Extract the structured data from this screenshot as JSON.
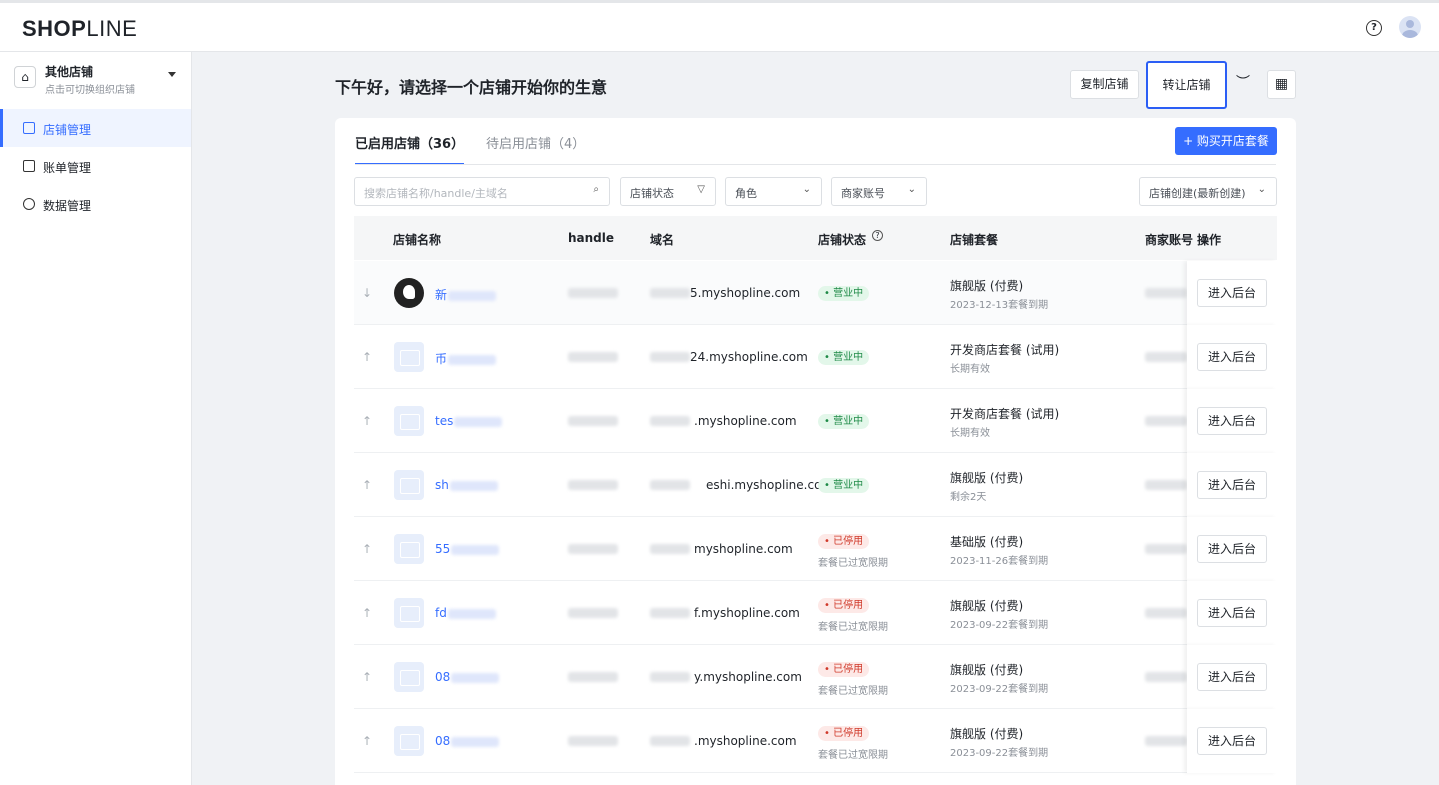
{
  "header": {
    "logo": "SHOPLINE",
    "help_icon": "question-circle-icon",
    "avatar_icon": "user-avatar-icon"
  },
  "sidebar": {
    "org_name": "其他店铺",
    "org_sub": "点击可切换组织店铺",
    "items": [
      {
        "label": "店铺管理",
        "icon": "store-icon",
        "active": true
      },
      {
        "label": "账单管理",
        "icon": "bill-icon",
        "active": false
      },
      {
        "label": "数据管理",
        "icon": "dashboard-icon",
        "active": false
      }
    ]
  },
  "main": {
    "greeting": "下午好，请选择一个店铺开始你的生意",
    "copy_store": "复制店铺",
    "transfer_store": "转让店铺",
    "tabs": [
      "已启用店铺（36）",
      "待启用店铺（4）"
    ],
    "buy_button": "+ 购买开店套餐",
    "search_placeholder": "搜索店铺名称/handle/主域名",
    "filters": [
      "店铺状态",
      "角色",
      "商家账号"
    ],
    "sort": "店铺创建(最新创建)",
    "columns": [
      "店铺名称",
      "handle",
      "域名",
      "店铺状态",
      "店铺套餐",
      "商家账号",
      "操作"
    ],
    "enter_label": "进入后台",
    "accent_color": "#356dff"
  },
  "rows": [
    {
      "pin": "↓",
      "name": "新",
      "domain": "5.myshopline.com",
      "status": "营业中",
      "grace": "",
      "plan": "旗舰版 (付费)",
      "plan_sub": "2023-12-13套餐到期",
      "logo": true
    },
    {
      "pin": "↑",
      "name": "币",
      "domain": "24.myshopline.com",
      "status": "营业中",
      "grace": "",
      "plan": "开发商店套餐 (试用)",
      "plan_sub": "长期有效",
      "logo": false
    },
    {
      "pin": "↑",
      "name": "tes",
      "domain": ".myshopline.com",
      "status": "营业中",
      "grace": "",
      "plan": "开发商店套餐 (试用)",
      "plan_sub": "长期有效",
      "logo": false
    },
    {
      "pin": "↑",
      "name": "sh",
      "domain": "eshi.myshopline.com",
      "status": "营业中",
      "grace": "",
      "plan": "旗舰版 (付费)",
      "plan_sub": "剩余2天",
      "logo": false
    },
    {
      "pin": "↑",
      "name": "55",
      "domain": "myshopline.com",
      "status": "已停用",
      "grace": "套餐已过宽限期",
      "plan": "基础版 (付费)",
      "plan_sub": "2023-11-26套餐到期",
      "logo": false
    },
    {
      "pin": "↑",
      "name": "fd",
      "domain": "f.myshopline.com",
      "status": "已停用",
      "grace": "套餐已过宽限期",
      "plan": "旗舰版 (付费)",
      "plan_sub": "2023-09-22套餐到期",
      "logo": false
    },
    {
      "pin": "↑",
      "name": "08",
      "domain": "y.myshopline.com",
      "status": "已停用",
      "grace": "套餐已过宽限期",
      "plan": "旗舰版 (付费)",
      "plan_sub": "2023-09-22套餐到期",
      "logo": false
    },
    {
      "pin": "↑",
      "name": "08",
      "domain": ".myshopline.com",
      "status": "已停用",
      "grace": "套餐已过宽限期",
      "plan": "旗舰版 (付费)",
      "plan_sub": "2023-09-22套餐到期",
      "logo": false
    }
  ]
}
